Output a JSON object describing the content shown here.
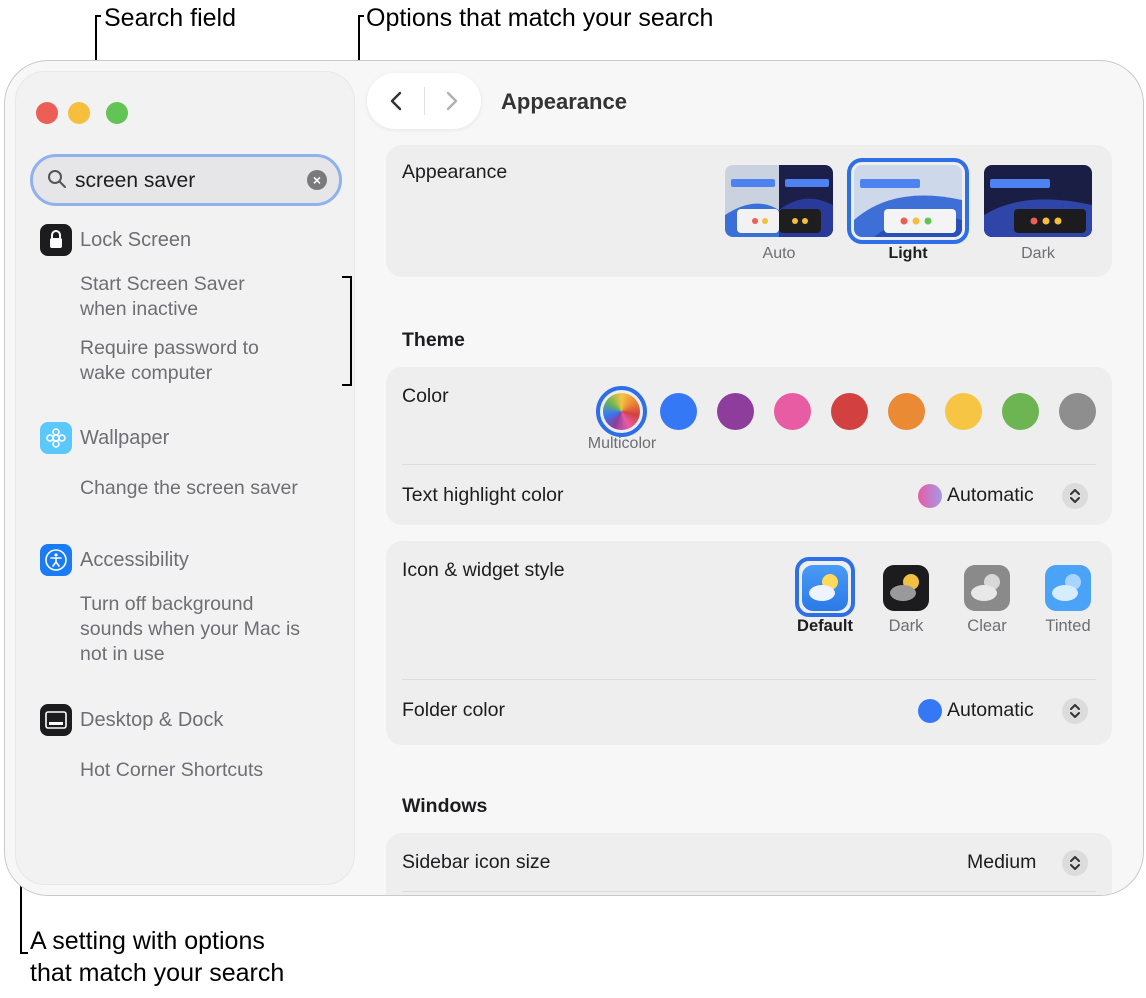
{
  "callouts": {
    "search_field": "Search field",
    "options_match": "Options that match your search",
    "setting_line1": "A setting with options",
    "setting_line2": "that match your search"
  },
  "sidebar": {
    "search": {
      "value": "screen saver"
    },
    "groups": [
      {
        "title": "Lock Screen",
        "icon": "lock-icon",
        "items": [
          "Start Screen Saver\nwhen inactive",
          "Require password to\nwake computer"
        ]
      },
      {
        "title": "Wallpaper",
        "icon": "wallpaper-icon",
        "items": [
          "Change the screen saver"
        ]
      },
      {
        "title": "Accessibility",
        "icon": "accessibility-icon",
        "items": [
          "Turn off background\nsounds when your Mac is\nnot in use"
        ]
      },
      {
        "title": "Desktop & Dock",
        "icon": "dock-icon",
        "items": [
          "Hot Corner Shortcuts"
        ]
      }
    ]
  },
  "header": {
    "title": "Appearance"
  },
  "appearance": {
    "label": "Appearance",
    "options": [
      "Auto",
      "Light",
      "Dark"
    ],
    "selected": "Light"
  },
  "theme": {
    "section": "Theme",
    "color_label": "Color",
    "colors": [
      "multicolor",
      "#3478f6",
      "#8e3d9c",
      "#e85ca4",
      "#d24040",
      "#ea8a35",
      "#f5c543",
      "#6db552",
      "#8e8e8e"
    ],
    "selected_color_label": "Multicolor",
    "highlight_label": "Text highlight color",
    "highlight_value": "Automatic"
  },
  "icon_style": {
    "label": "Icon & widget style",
    "options": [
      "Default",
      "Dark",
      "Clear",
      "Tinted"
    ],
    "selected": "Default",
    "folder_label": "Folder color",
    "folder_value": "Automatic"
  },
  "windows": {
    "section": "Windows",
    "sidebar_icon_label": "Sidebar icon size",
    "sidebar_icon_value": "Medium"
  },
  "colors": {
    "accent": "#2e6fe8"
  }
}
